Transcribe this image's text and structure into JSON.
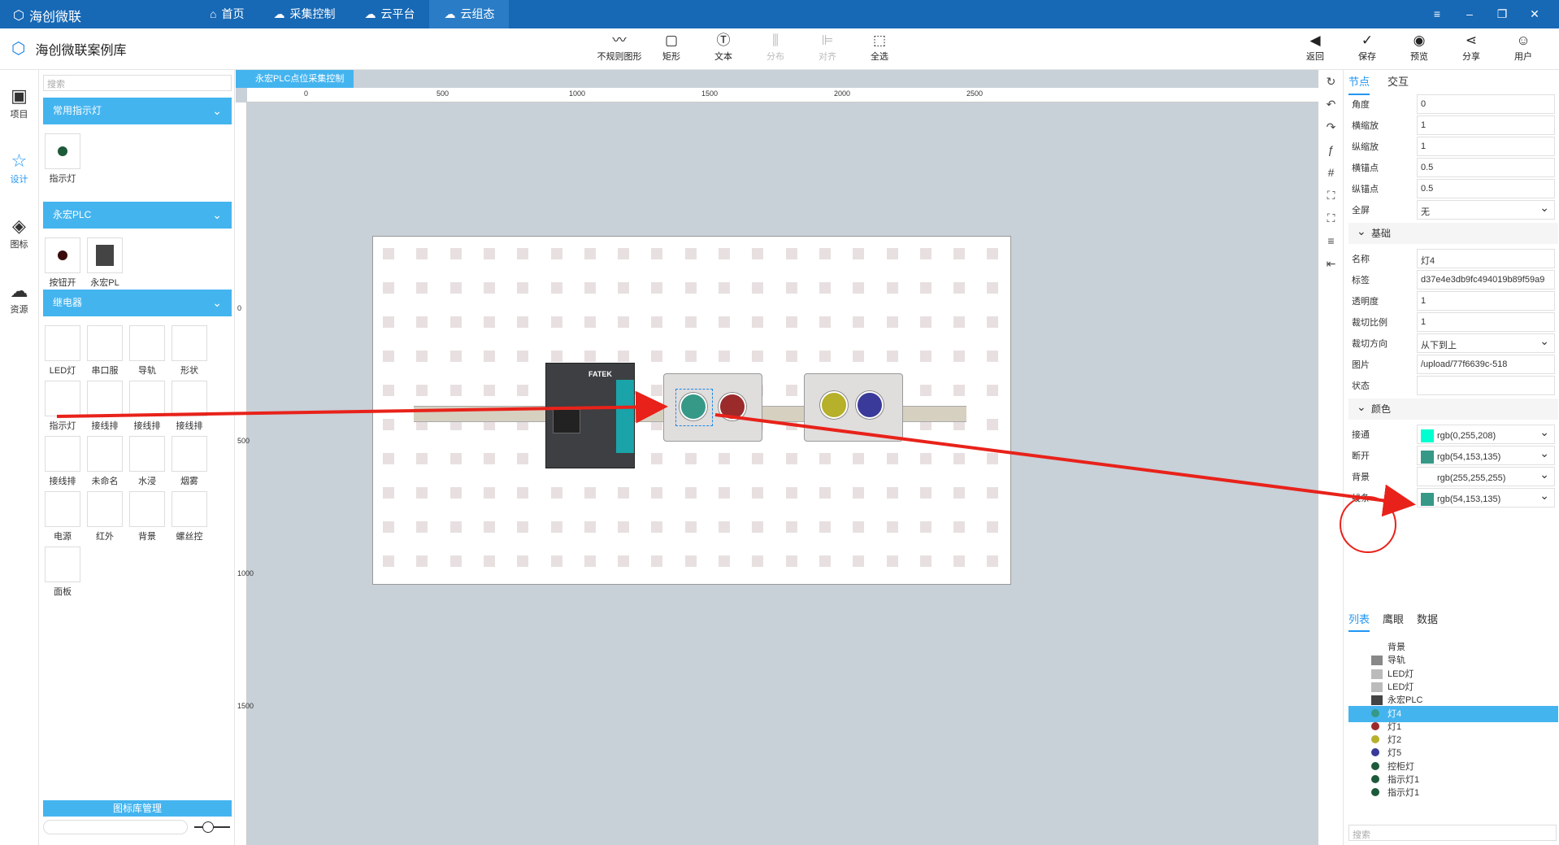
{
  "app": {
    "title": "海创微联"
  },
  "nav": {
    "tabs": [
      {
        "label": "首页"
      },
      {
        "label": "采集控制"
      },
      {
        "label": "云平台"
      },
      {
        "label": "云组态"
      }
    ]
  },
  "window": {
    "minimize": "–",
    "restore": "❐",
    "close": "✕",
    "menu": "≡"
  },
  "project": {
    "title": "海创微联案例库"
  },
  "toolbar": {
    "tools": [
      {
        "label": "不规则图形"
      },
      {
        "label": "矩形"
      },
      {
        "label": "文本"
      },
      {
        "label": "分布"
      },
      {
        "label": "对齐"
      },
      {
        "label": "全选"
      }
    ],
    "right": [
      {
        "label": "返回"
      },
      {
        "label": "保存"
      },
      {
        "label": "预览"
      },
      {
        "label": "分享"
      },
      {
        "label": "用户"
      }
    ]
  },
  "leftnav": {
    "items": [
      {
        "label": "项目"
      },
      {
        "label": "设计"
      },
      {
        "label": "图标"
      },
      {
        "label": "资源"
      }
    ]
  },
  "palette": {
    "search_placeholder": "搜索",
    "cat1": "常用指示灯",
    "cat1_items": [
      "指示灯"
    ],
    "cat2": "永宏PLC",
    "cat2_items": [
      "按钮开",
      "永宏PL"
    ],
    "cat3": "继电器",
    "cat3_items": [
      "LED灯",
      "串口服",
      "导轨",
      "形状",
      "指示灯",
      "接线排",
      "接线排",
      "接线排",
      "接线排",
      "未命名",
      "水浸",
      "烟雾",
      "电源",
      "红外",
      "背景",
      "螺丝控",
      "面板"
    ],
    "footer": "图标库管理"
  },
  "canvas": {
    "doc_tab": "永宏PLC点位采集控制",
    "hruler": [
      "0",
      "500",
      "1000",
      "1500",
      "2000",
      "2500"
    ],
    "vruler": [
      "0",
      "500",
      "1000",
      "1500"
    ],
    "plc_label": "FATEK"
  },
  "props": {
    "tabs": [
      "节点",
      "交互"
    ],
    "rows": [
      {
        "k": "角度",
        "v": "0"
      },
      {
        "k": "横缩放",
        "v": "1"
      },
      {
        "k": "纵缩放",
        "v": "1"
      },
      {
        "k": "横锚点",
        "v": "0.5"
      },
      {
        "k": "纵锚点",
        "v": "0.5"
      },
      {
        "k": "全屏",
        "v": "无"
      }
    ],
    "basic": "基础",
    "basic_rows": [
      {
        "k": "名称",
        "v": "灯4"
      },
      {
        "k": "标签",
        "v": "d37e4e3db9fc494019b89f59a9"
      },
      {
        "k": "透明度",
        "v": "1"
      },
      {
        "k": "裁切比例",
        "v": "1"
      },
      {
        "k": "裁切方向",
        "v": "从下到上"
      },
      {
        "k": "图片",
        "v": "/upload/77f6639c-518"
      },
      {
        "k": "状态",
        "v": ""
      }
    ],
    "color_section": "颜色",
    "colors": [
      {
        "k": "接通",
        "v": "rgb(0,255,208)",
        "c": "#00ffd0"
      },
      {
        "k": "断开",
        "v": "rgb(54,153,135)",
        "c": "#369987"
      },
      {
        "k": "背景",
        "v": "rgb(255,255,255)",
        "c": "#ffffff"
      },
      {
        "k": "线条",
        "v": "rgb(54,153,135)",
        "c": "#369987"
      }
    ]
  },
  "layers": {
    "tabs": [
      "列表",
      "鹰眼",
      "数据"
    ],
    "items": [
      "背景",
      "导轨",
      "LED灯",
      "LED灯",
      "永宏PLC",
      "灯4",
      "灯1",
      "灯2",
      "灯5",
      "控柜灯",
      "指示灯1",
      "指示灯1"
    ],
    "selected": "灯4",
    "search_placeholder": "搜索"
  },
  "lamps": {
    "lamp4": "#369987",
    "lamp1": "#9b2a2a",
    "lamp2": "#b6b02a",
    "lamp5": "#3a3a9a"
  }
}
